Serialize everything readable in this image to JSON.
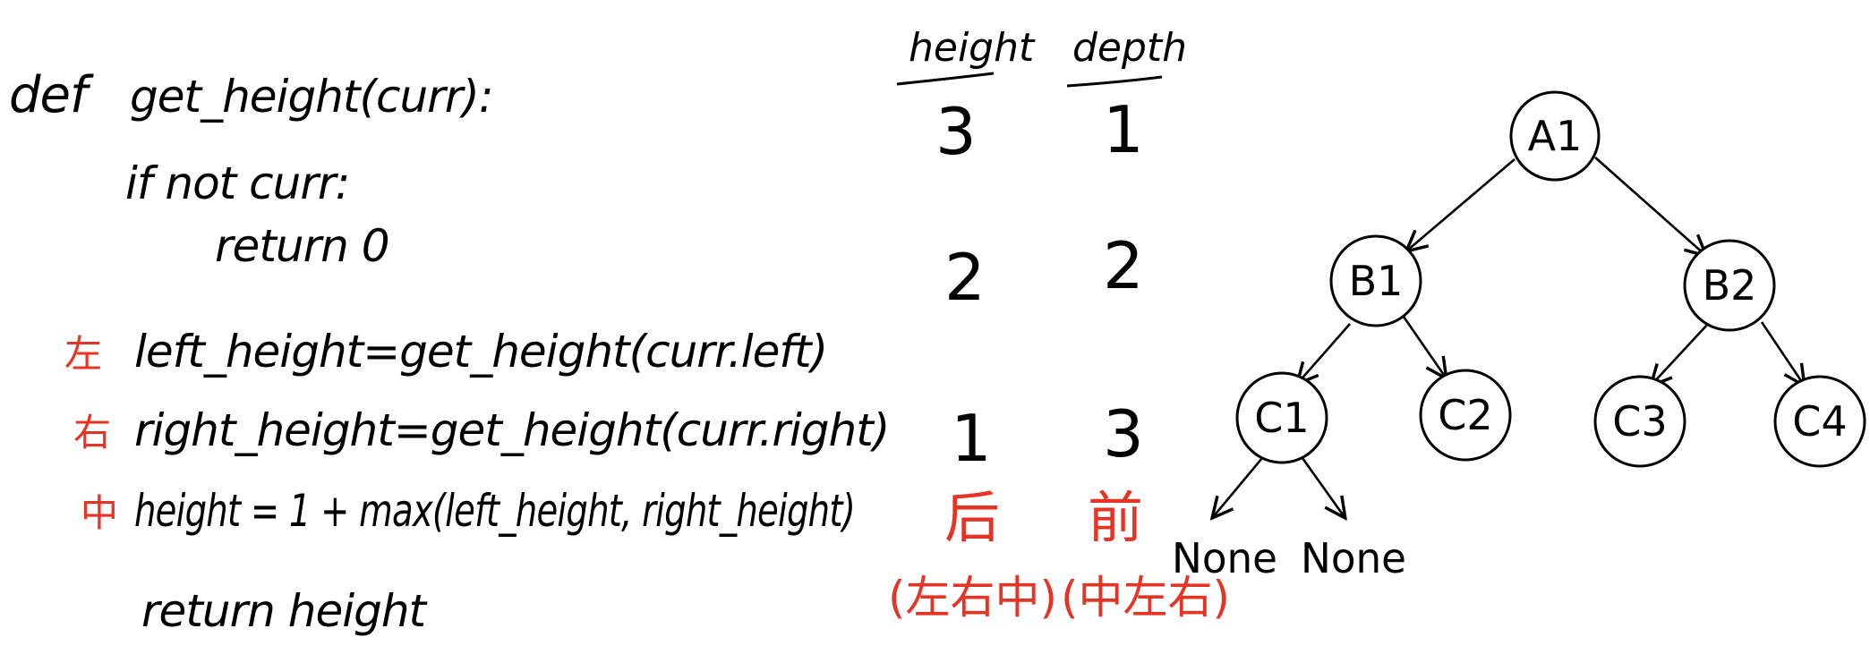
{
  "code": {
    "def_keyword": "def",
    "signature": "get_height(curr):",
    "if_line": "if not curr:",
    "return_zero": "return 0",
    "left_line": "left_height=get_height(curr.left)",
    "right_line": "right_height=get_height(curr.right)",
    "mid_line": "height = 1 + max(left_height, right_height)",
    "return_height": "return height",
    "markers": {
      "left": "左",
      "right": "右",
      "mid": "中"
    }
  },
  "table": {
    "height_header": "height",
    "depth_header": "depth",
    "rows": [
      {
        "height": "3",
        "depth": "1"
      },
      {
        "height": "2",
        "depth": "2"
      },
      {
        "height": "1",
        "depth": "3"
      }
    ],
    "height_order": "后",
    "height_order_detail": "(左右中)",
    "depth_order": "前",
    "depth_order_detail": "(中左右)"
  },
  "tree": {
    "nodes": {
      "A1": "A1",
      "B1": "B1",
      "B2": "B2",
      "C1": "C1",
      "C2": "C2",
      "C3": "C3",
      "C4": "C4"
    },
    "none_left": "None",
    "none_right": "None"
  },
  "colors": {
    "ink": "#000000",
    "accent": "#e53325",
    "background": "#ffffff"
  }
}
